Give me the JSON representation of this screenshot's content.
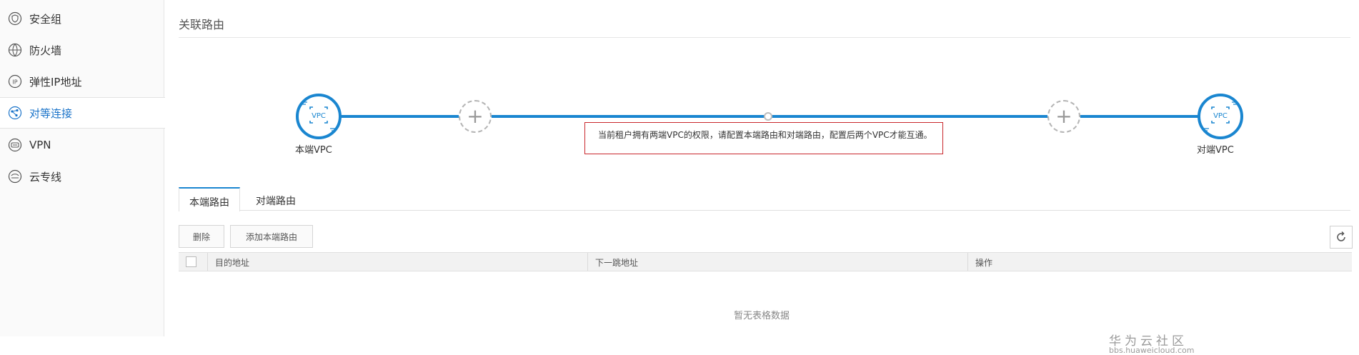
{
  "sidebar": {
    "items": [
      {
        "label": "安全组",
        "icon": "shield-icon"
      },
      {
        "label": "防火墙",
        "icon": "globe-icon"
      },
      {
        "label": "弹性IP地址",
        "icon": "ip-icon"
      },
      {
        "label": "对等连接",
        "icon": "peering-icon",
        "active": true
      },
      {
        "label": "VPN",
        "icon": "vpn-icon"
      },
      {
        "label": "云专线",
        "icon": "direct-connect-icon"
      }
    ]
  },
  "main": {
    "title": "关联路由",
    "topology": {
      "left_node_text": "VPC",
      "left_label": "本端VPC",
      "right_node_text": "VPC",
      "right_label": "对端VPC",
      "notice": "当前租户拥有两端VPC的权限，请配置本端路由和对端路由，配置后两个VPC才能互通。"
    },
    "tabs": [
      {
        "label": "本端路由",
        "active": true
      },
      {
        "label": "对端路由",
        "active": false
      }
    ],
    "toolbar": {
      "delete_label": "删除",
      "add_label": "添加本端路由"
    },
    "table": {
      "columns": [
        "目的地址",
        "下一跳地址",
        "操作"
      ],
      "empty_text": "暂无表格数据"
    }
  },
  "watermark": {
    "main": "华为云社区",
    "sub": "bbs.huaweicloud.com"
  },
  "colors": {
    "accent": "#1a86d0",
    "active_nav_text": "#1a73c9",
    "notice_border": "#c9282d"
  }
}
